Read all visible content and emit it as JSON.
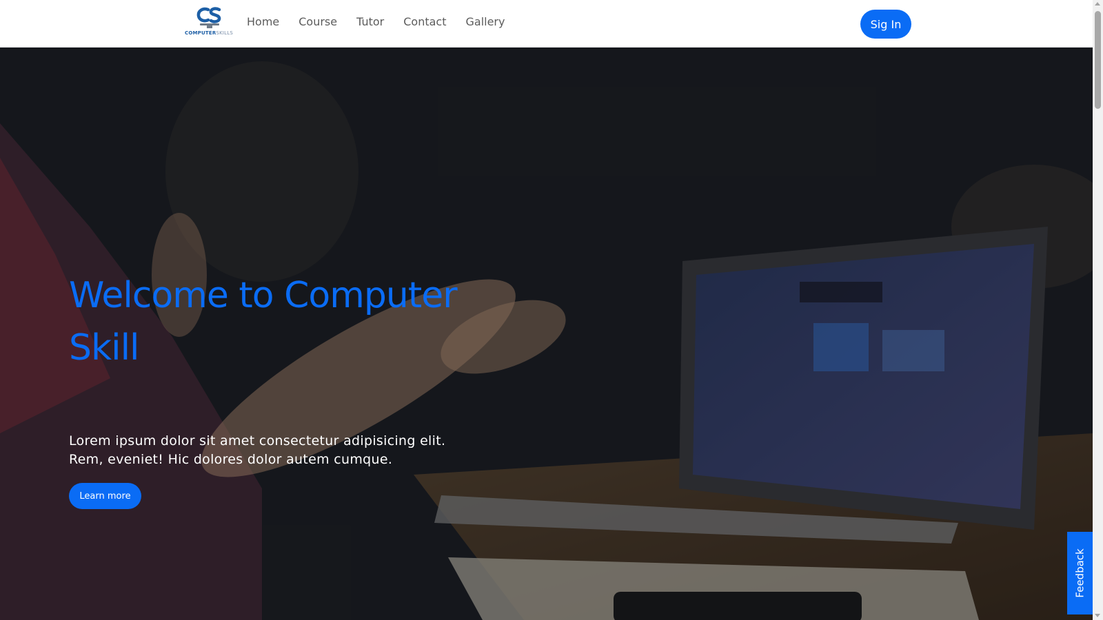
{
  "header": {
    "logo": {
      "word1": "COMPUTER",
      "word2": "SKILLS"
    },
    "nav": [
      {
        "label": "Home"
      },
      {
        "label": "Course"
      },
      {
        "label": "Tutor"
      },
      {
        "label": "Contact"
      },
      {
        "label": "Gallery"
      }
    ],
    "signin_label": "Sig In"
  },
  "hero": {
    "title": "Welcome to Computer Skill",
    "description": "Lorem ipsum dolor sit amet consectetur adipisicing elit. Rem, eveniet! Hic dolores dolor autem cumque.",
    "cta_label": "Learn more"
  },
  "feedback": {
    "label": "Feedback"
  },
  "colors": {
    "accent": "#0a6cf5",
    "nav_text": "#5c5c5c",
    "hero_text": "#ffffff"
  }
}
